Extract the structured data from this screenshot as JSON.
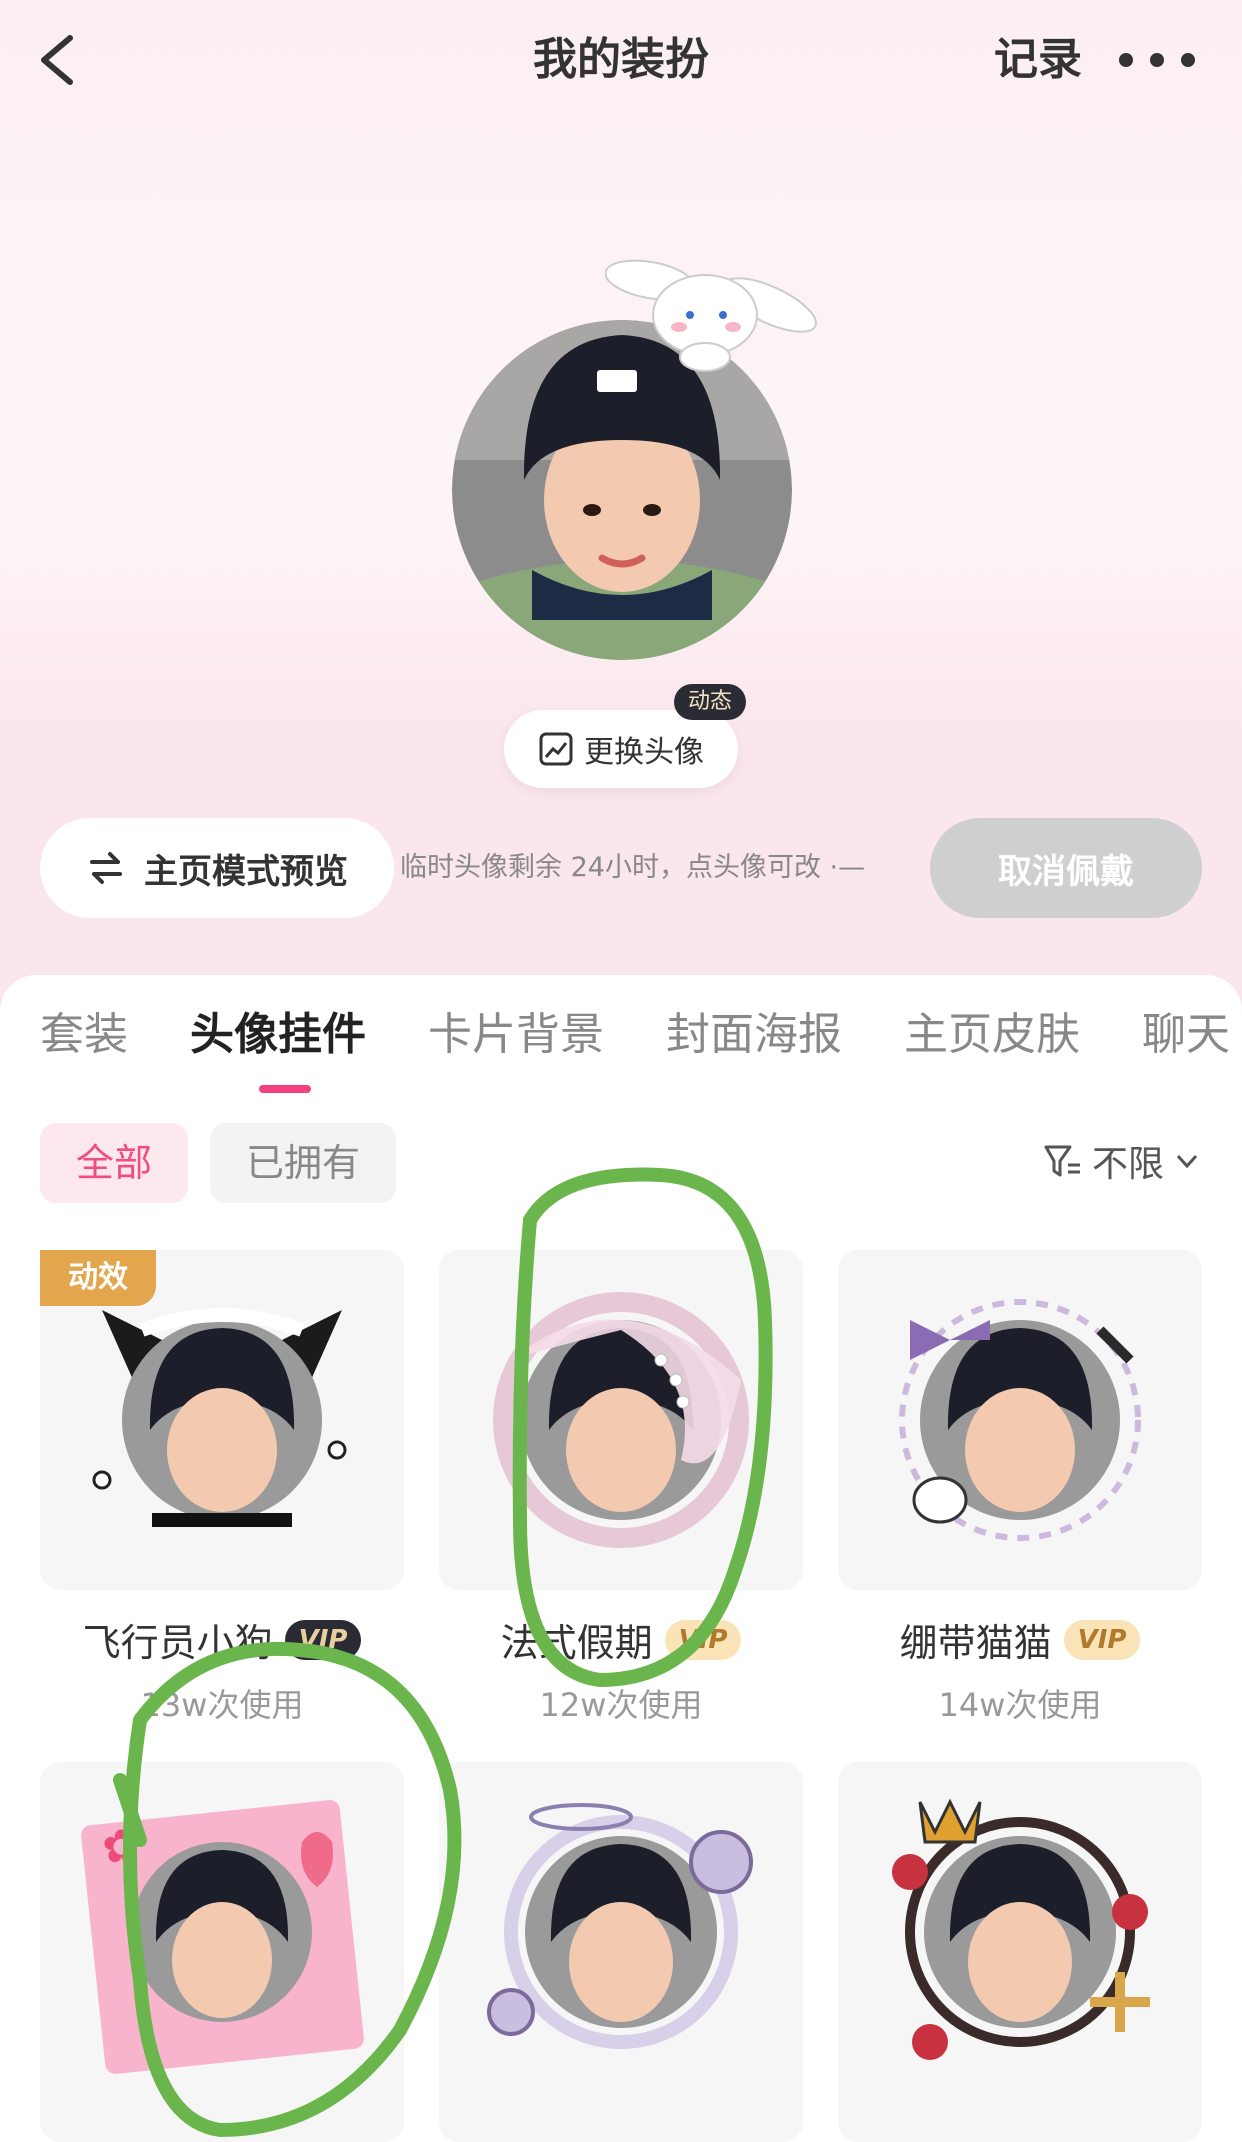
{
  "header": {
    "title": "我的装扮",
    "record": "记录"
  },
  "profile": {
    "change_avatar": "更换头像",
    "dynamic_badge": "动态",
    "preview_mode": "主页模式预览",
    "hint": "临时头像剩余 24小时，点头像可改 ·—",
    "cancel_wear": "取消佩戴"
  },
  "tabs": [
    "套装",
    "头像挂件",
    "卡片背景",
    "封面海报",
    "主页皮肤",
    "聊天"
  ],
  "active_tab": 1,
  "filters": {
    "all": "全部",
    "owned": "已拥有",
    "sort": "不限"
  },
  "items": [
    {
      "name": "飞行员小狗",
      "vip": "VIP",
      "usage": "13w次使用",
      "tag": "动效"
    },
    {
      "name": "法式假期",
      "vip": "VIP",
      "usage": "12w次使用"
    },
    {
      "name": "绷带猫猫",
      "vip": "VIP",
      "usage": "14w次使用"
    },
    {
      "name": "",
      "vip": "",
      "usage": ""
    },
    {
      "name": "",
      "vip": "",
      "usage": ""
    },
    {
      "name": "",
      "vip": "",
      "usage": ""
    }
  ],
  "colors": {
    "accent": "#f3427f",
    "annotation_circle": "#6ab64c"
  }
}
